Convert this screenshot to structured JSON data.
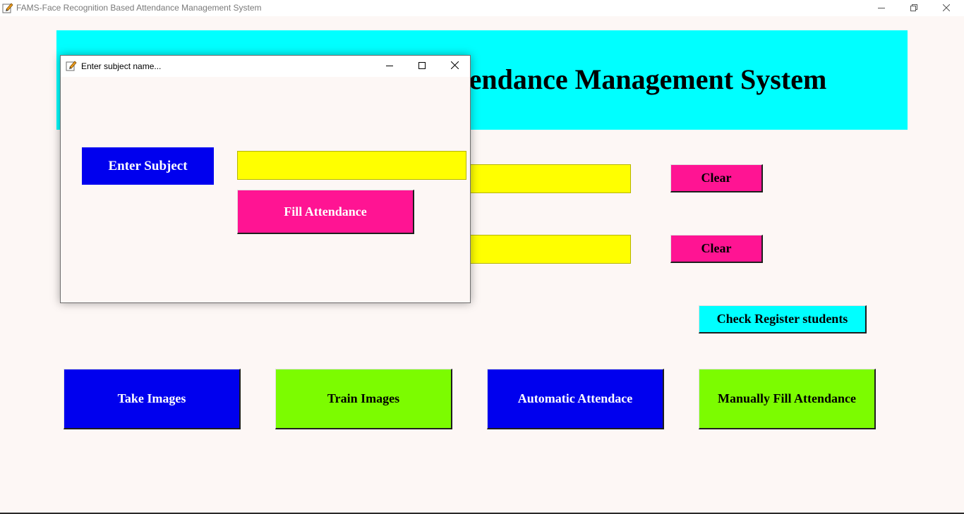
{
  "window": {
    "title": "FAMS-Face Recognition Based Attendance Management System"
  },
  "header": {
    "title": "Face Recognition Based Attendance Management System"
  },
  "main": {
    "clear_button_1": "Clear",
    "clear_button_2": "Clear",
    "check_register_button": "Check Register students",
    "take_images_button": "Take Images",
    "train_images_button": "Train Images",
    "automatic_attendance_button": "Automatic Attendace",
    "manual_attendance_button": "Manually Fill Attendance",
    "entry_1_value": "",
    "entry_2_value": ""
  },
  "dialog": {
    "title": "Enter subject name...",
    "enter_subject_label": "Enter Subject",
    "subject_value": "",
    "fill_attendance_button": "Fill Attendance"
  },
  "colors": {
    "background": "#fdf7f5",
    "header": "#00ffff",
    "entry": "#ffff00",
    "clear_button": "#ff1493",
    "blue_button": "#0000ee",
    "green_button": "#7cfc00",
    "cyan_button": "#00ffff"
  },
  "icons": [
    "app-pencil-icon",
    "minimize-icon",
    "restore-icon",
    "close-icon",
    "maximize-icon"
  ]
}
